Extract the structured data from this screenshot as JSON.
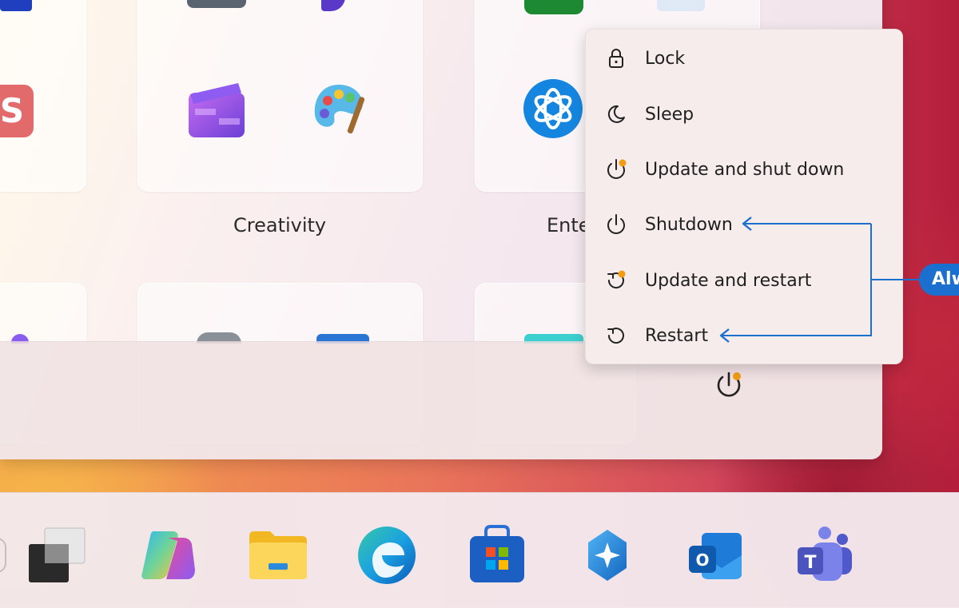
{
  "folders": [
    {
      "label": "Creativity"
    },
    {
      "label": "Ente"
    }
  ],
  "power_menu": {
    "items": [
      {
        "label": "Lock",
        "icon": "lock-icon"
      },
      {
        "label": "Sleep",
        "icon": "moon-icon"
      },
      {
        "label": "Update and shut down",
        "icon": "power-update-icon"
      },
      {
        "label": "Shutdown",
        "icon": "power-icon"
      },
      {
        "label": "Update and restart",
        "icon": "restart-update-icon"
      },
      {
        "label": "Restart",
        "icon": "restart-icon"
      }
    ]
  },
  "callout": {
    "text": "Alw"
  },
  "colors": {
    "accent": "#1a6fcf",
    "update_dot": "#f39c12"
  },
  "taskbar": {
    "icons": [
      "task-view-icon",
      "copilot-icon",
      "file-explorer-icon",
      "edge-icon",
      "store-icon",
      "copilot-app-icon",
      "outlook-icon",
      "teams-icon"
    ]
  }
}
